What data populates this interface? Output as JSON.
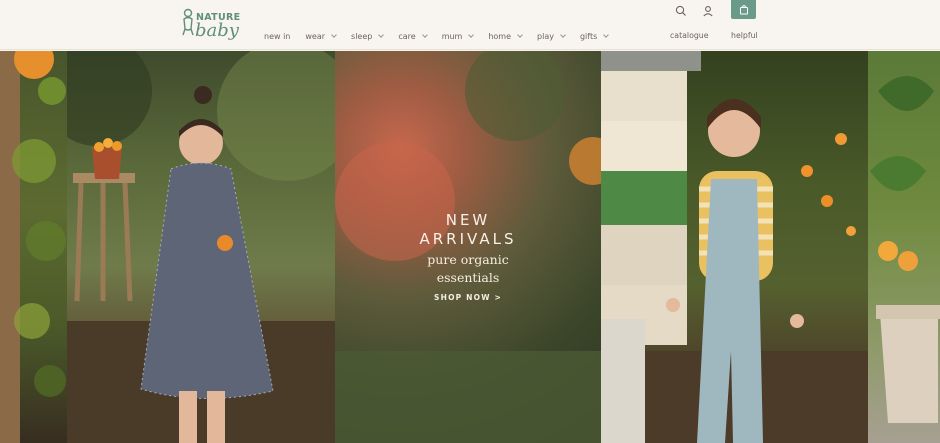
{
  "header": {
    "logo": {
      "line1": "NATURE",
      "line2": "baby"
    },
    "nav": [
      {
        "label": "new in",
        "dropdown": false
      },
      {
        "label": "wear",
        "dropdown": true
      },
      {
        "label": "sleep",
        "dropdown": true
      },
      {
        "label": "care",
        "dropdown": true
      },
      {
        "label": "mum",
        "dropdown": true
      },
      {
        "label": "home",
        "dropdown": true
      },
      {
        "label": "play",
        "dropdown": true
      },
      {
        "label": "gifts",
        "dropdown": true
      }
    ],
    "utility": {
      "catalogue": "catalogue",
      "helpful": "helpful"
    },
    "icons": {
      "search": "search-icon",
      "account": "user-icon",
      "cart": "shopping-bag-icon"
    },
    "colors": {
      "brand": "#5f8f7c",
      "cart_button": "#6a9a8a",
      "header_bg": "#f8f4ef"
    }
  },
  "hero": {
    "title_line1": "NEW",
    "title_line2": "ARRIVALS",
    "subtitle_line1": "pure organic",
    "subtitle_line2": "essentials",
    "cta": "SHOP NOW >"
  }
}
